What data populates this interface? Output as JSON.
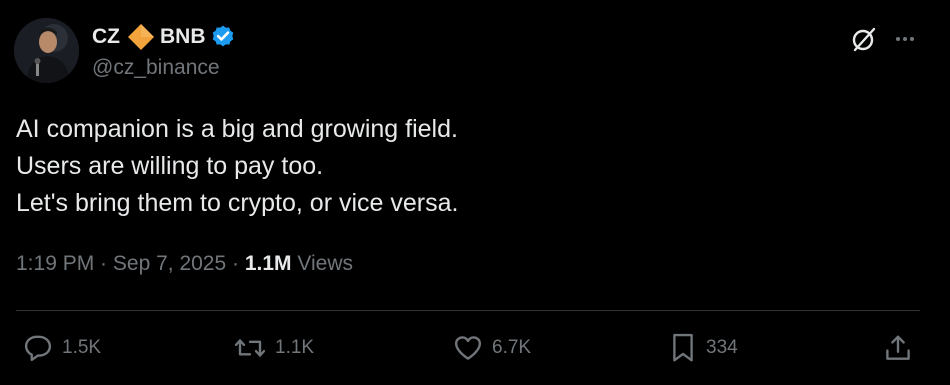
{
  "author": {
    "name": "CZ",
    "name_suffix": "BNB",
    "handle": "@cz_binance"
  },
  "icons": {
    "avatar": "profile-photo",
    "diamond": "bnb-diamond-emoji",
    "verified": "verified-badge-icon",
    "grok": "grok-icon",
    "more": "more-options-icon",
    "reply": "reply-icon",
    "retweet": "retweet-icon",
    "like": "heart-icon",
    "bookmark": "bookmark-icon",
    "share": "share-icon"
  },
  "colors": {
    "background": "#000000",
    "text": "#e7e9ea",
    "secondary": "#71767b",
    "verified": "#1d9bf0",
    "diamond": "#f3a33b",
    "divider": "#2f3336"
  },
  "tweet": {
    "lines": [
      "AI companion is a big and growing field.",
      "Users are willing to pay too.",
      "Let's bring them to crypto, or vice versa."
    ]
  },
  "meta": {
    "time": "1:19 PM",
    "date": "Sep 7, 2025",
    "views_count": "1.1M",
    "views_label": "Views"
  },
  "actions": {
    "replies": "1.5K",
    "retweets": "1.1K",
    "likes": "6.7K",
    "bookmarks": "334"
  }
}
